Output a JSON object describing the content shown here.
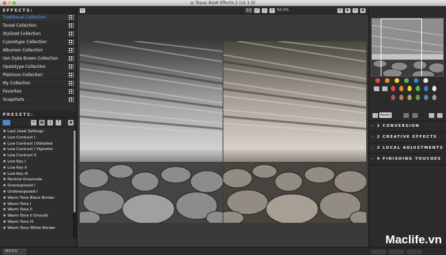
{
  "window": {
    "title": "Topaz B&W Effects 2 (v2.1.0)"
  },
  "effects": {
    "header": "EFFECTS:",
    "collections": [
      {
        "label": "Traditional Collection",
        "active": true
      },
      {
        "label": "Toned Collection",
        "active": false
      },
      {
        "label": "Stylized Collection",
        "active": false
      },
      {
        "label": "Cyanotype Collection",
        "active": false
      },
      {
        "label": "Albumen Collection",
        "active": false
      },
      {
        "label": "Van Dyke Brown Collection",
        "active": false
      },
      {
        "label": "Opalotype Collection",
        "active": false
      },
      {
        "label": "Platinum Collection",
        "active": false
      },
      {
        "label": "My Collection",
        "active": false
      },
      {
        "label": "Favorites",
        "active": false
      },
      {
        "label": "Snapshots",
        "active": false
      }
    ]
  },
  "presets": {
    "header": "PRESETS:",
    "items": [
      "Last Used Settings",
      "Low Contrast I",
      "Low Contrast I Detailed",
      "Low Contrast I Vignette",
      "Low Contrast II",
      "Low Key I",
      "Low Key II",
      "Low Key III",
      "Neutral Grayscale",
      "Overexposed I",
      "Underexposed I",
      "Warm Tone Black Border",
      "Warm Tone I",
      "Warm Tone II",
      "Warm Tone II Smooth",
      "Warm Tone III",
      "Warm Tone White Border"
    ]
  },
  "toolbar": {
    "fit_label": "1:1",
    "zoom_label": "50.0%"
  },
  "right_panel": {
    "apply_label": "Apply",
    "sections": [
      {
        "number": "1",
        "label": "CONVERSION"
      },
      {
        "number": "2",
        "label": "CREATIVE EFFECTS"
      },
      {
        "number": "3",
        "label": "LOCAL ADJUSTMENTS"
      },
      {
        "number": "4",
        "label": "FINISHING TOUCHES"
      }
    ],
    "color_dots": [
      "#e64a3a",
      "#f08a2a",
      "#e9d23a",
      "#55b84a",
      "#3f7fd1",
      "#e8e8e8"
    ]
  },
  "bottom": {
    "menu_label": "MENU..."
  },
  "watermark": "Maclife.vn"
}
